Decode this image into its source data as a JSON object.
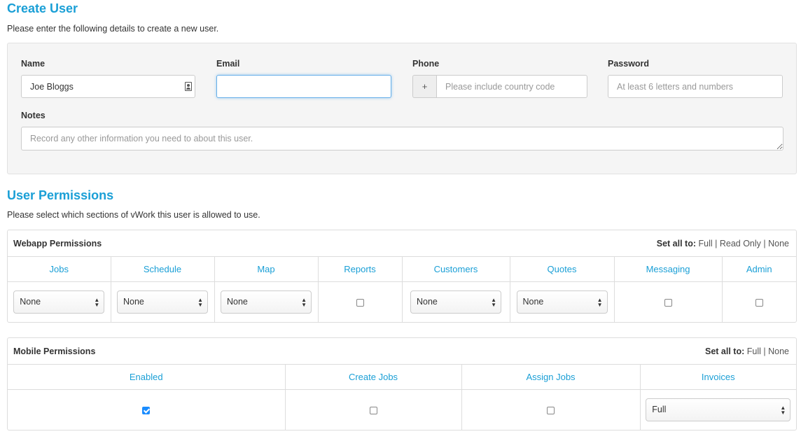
{
  "create_user": {
    "title": "Create User",
    "subtitle": "Please enter the following details to create a new user.",
    "name_label": "Name",
    "name_value": "Joe Bloggs",
    "email_label": "Email",
    "email_value": "",
    "phone_label": "Phone",
    "phone_prefix": "+",
    "phone_placeholder": "Please include country code",
    "password_label": "Password",
    "password_placeholder": "At least 6 letters and numbers",
    "notes_label": "Notes",
    "notes_placeholder": "Record any other information you need to about this user."
  },
  "permissions": {
    "title": "User Permissions",
    "subtitle": "Please select which sections of vWork this user is allowed to use.",
    "set_all_label": "Set all to:",
    "webapp": {
      "title": "Webapp Permissions",
      "set_all": [
        "Full",
        "Read Only",
        "None"
      ],
      "columns": [
        "Jobs",
        "Schedule",
        "Map",
        "Reports",
        "Customers",
        "Quotes",
        "Messaging",
        "Admin"
      ],
      "values": [
        "None",
        "None",
        "None",
        false,
        "None",
        "None",
        false,
        false
      ]
    },
    "mobile": {
      "title": "Mobile Permissions",
      "set_all": [
        "Full",
        "None"
      ],
      "columns": [
        "Enabled",
        "Create Jobs",
        "Assign Jobs",
        "Invoices"
      ],
      "values": [
        true,
        false,
        false,
        "Full"
      ]
    }
  }
}
